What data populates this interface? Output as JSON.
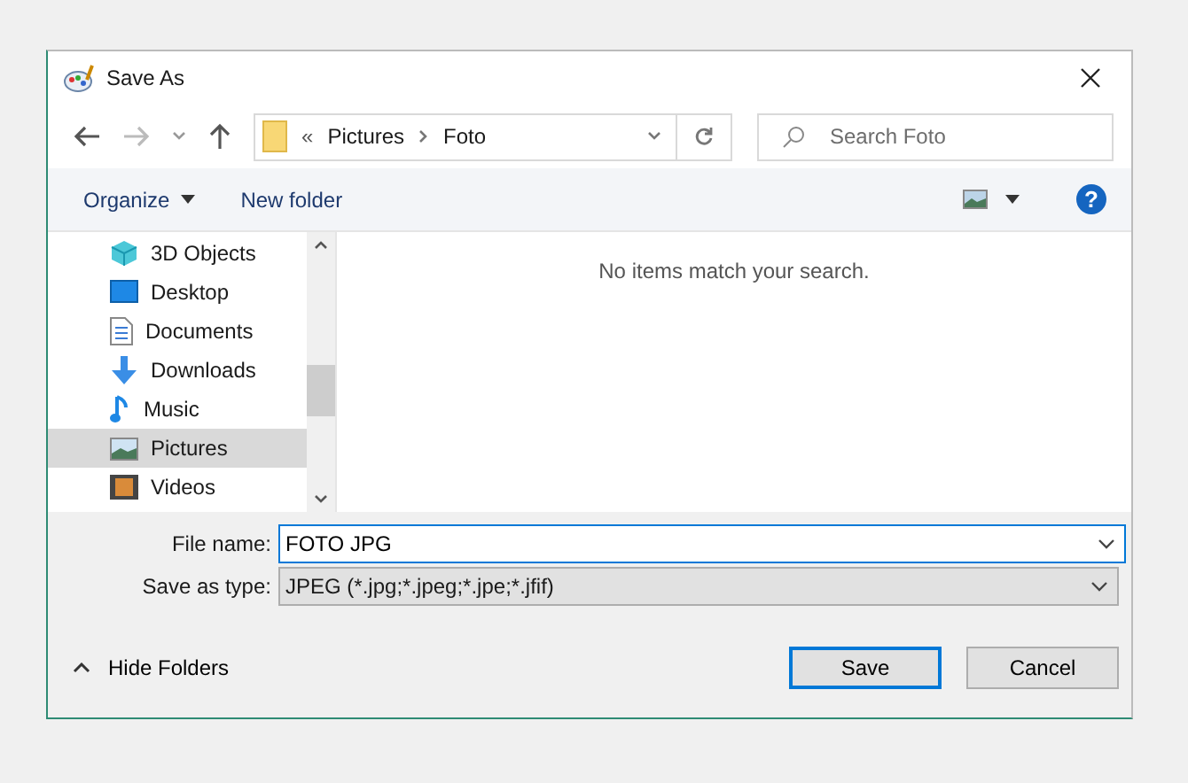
{
  "window": {
    "title": "Save As"
  },
  "address_bar": {
    "prefix": "«",
    "path": [
      "Pictures",
      "Foto"
    ]
  },
  "search": {
    "placeholder": "Search Foto"
  },
  "toolbar": {
    "organize": "Organize",
    "new_folder": "New folder",
    "help": "?"
  },
  "sidebar": {
    "items": [
      {
        "label": "3D Objects",
        "kind": "cube",
        "selected": false
      },
      {
        "label": "Desktop",
        "kind": "desktop",
        "selected": false
      },
      {
        "label": "Documents",
        "kind": "document",
        "selected": false
      },
      {
        "label": "Downloads",
        "kind": "download",
        "selected": false
      },
      {
        "label": "Music",
        "kind": "music",
        "selected": false
      },
      {
        "label": "Pictures",
        "kind": "picture",
        "selected": true
      },
      {
        "label": "Videos",
        "kind": "video",
        "selected": false
      }
    ]
  },
  "content": {
    "empty_message": "No items match your search."
  },
  "form": {
    "file_name_label": "File name:",
    "file_name": "FOTO JPG",
    "type_label": "Save as type:",
    "type": "JPEG (*.jpg;*.jpeg;*.jpe;*.jfif)"
  },
  "footer": {
    "hide_folders": "Hide Folders",
    "buttons": [
      "Save",
      "Cancel"
    ]
  }
}
